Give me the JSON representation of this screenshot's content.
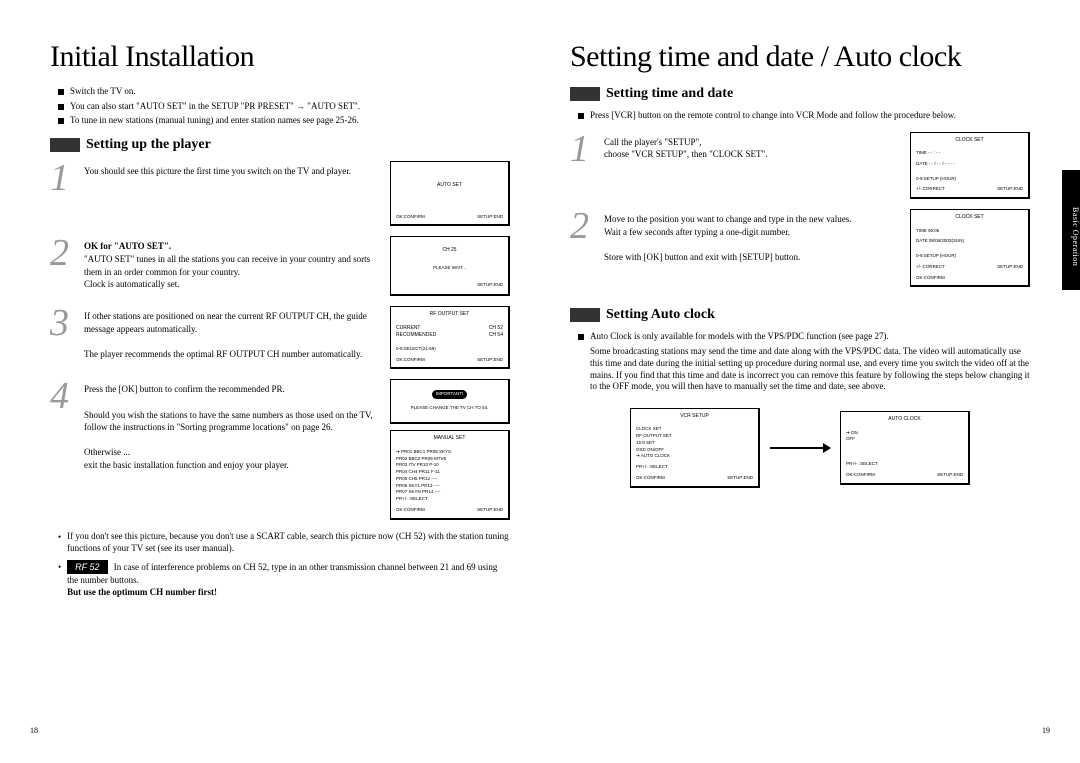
{
  "left": {
    "title": "Initial Installation",
    "intro": [
      "Switch the TV on.",
      "You can also start \"AUTO SET\" in the SETUP \"PR PRESET\"  →  \"AUTO SET\".",
      "To tune in new stations (manual tuning) and enter station names see page 25-26."
    ],
    "section1": "Setting up the player",
    "steps": {
      "s1": "You should see this picture the first time you switch on the TV and player.",
      "s2a": "OK for \"AUTO SET\".",
      "s2b": "\"AUTO SET\" tunes in all the stations you can receive in your country and sorts them in an order common for your country.",
      "s2c": "Clock is automatically set.",
      "s3a": "If other stations are positioned on near the current RF OUTPUT CH, the guide message appears automatically.",
      "s3b": "The player recommends the optimal RF OUTPUT CH number automatically.",
      "s4a": "Press the [OK] button to confirm the recommended PR.",
      "s4b": "Should you wish the stations to have the same numbers as those used on the TV, follow the instructions in \"Sorting programme locations\" on page 26.",
      "s4c": "Otherwise ...",
      "s4d": "exit the basic installation function and enjoy your player."
    },
    "osd1": {
      "title": "AUTO SET",
      "foot_l": "OK:CONFIRM",
      "foot_r": "SETUP:END"
    },
    "osd2": {
      "ch": "CH 25",
      "wait": "PLEASE WAIT...",
      "foot_r": "SETUP:END"
    },
    "osd3": {
      "title": "RF OUTPUT SET",
      "l1": "CURRENT",
      "v1": "CH 52",
      "l2": "RECOMMENDED",
      "v2": "CH 54",
      "foot_m": "0-9:SELECT(21-69)",
      "foot_l": "OK:CONFIRM",
      "foot_r": "SETUP:END"
    },
    "osd4": {
      "important": "IMPORTANT!",
      "msg": "PLEASE CHANGE THE TV CH TO 54."
    },
    "osd5": {
      "title": "MANUAL SET",
      "rows": [
        "➔ PR01 BBC1  PR08 SKYS",
        "PR02 BBC2  PR09 MTVE",
        "PR03 ITV   PR10 P-10",
        "PR04 CH4   PR11 F-11",
        "PR05 CH5   PR12 ----",
        "PR06 SKY1  PR13 ----",
        "PR07 SKYN  PR14 ----"
      ],
      "foot_m": "PR+/- :SELECT",
      "foot_l": "OK:CONFIRM",
      "foot_r": "SETUP:END"
    },
    "note1": "If you don't see this picture, because you don't use a SCART cable, search this picture now (CH 52) with the station tuning functions of your TV set (see its user manual).",
    "rf_label": "RF 52",
    "note2": "In case of interference problems on CH 52, type in an other transmission channel between 21 and 69 using the number buttons.",
    "note2b": "But use the optimum CH number first!",
    "page": "18"
  },
  "right": {
    "title": "Setting time and date / Auto clock",
    "section1": "Setting time and date",
    "intro1": "Press [VCR] button on the remote control to change into VCR Mode and follow the procedure below.",
    "steps": {
      "s1a": "Call the player's \"SETUP\",",
      "s1b": "choose \"VCR SETUP\", then \"CLOCK SET\".",
      "s2a": "Move to the position you want to change and type in the new values.",
      "s2b": "Wait a few seconds after typing a one-digit number.",
      "s2c": "Store with [OK] button and exit with [SETUP] button."
    },
    "osd1": {
      "title": "CLOCK SET",
      "time": "TIME   - - : - -",
      "date": "DATE   - - / - - / - - - -",
      "foot_m": "0-9:SETUP (HOUR)",
      "foot_m2": "+/-:CORRECT",
      "foot_r": "SETUP:END"
    },
    "osd2": {
      "title": "CLOCK SET",
      "time": "TIME   06:05",
      "date": "DATE   08/06/2003(SUN)",
      "foot_m": "0-9:SETUP (HOUR)",
      "foot_m2": "+/-:CORRECT",
      "foot_r": "SETUP:END",
      "foot_ok": "OK:CONFIRM"
    },
    "section2": "Setting Auto clock",
    "intro2": [
      "Auto Clock is only available for models with the VPS/PDC function (see page 27).",
      "Some broadcasting stations may send the time and date along with the VPS/PDC data. The video will automatically use this time and date during the initial setting up procedure during normal use, and every time you switch the video off at the mains. If you find that this time and date is incorrect you can remove this feature by following the steps below changing it to the OFF mode, you will then have to manually set the time and date, see above."
    ],
    "osdv": {
      "title": "VCR SETUP",
      "rows": [
        "CLOCK SET",
        "RF OUTPUT SET",
        "16:9 SET",
        "OSD ON/OFF",
        "➔ AUTO CLOCK"
      ],
      "foot_m": "PR+/- :SELECT",
      "foot_l": "OK:CONFIRM",
      "foot_r": "SETUP:END"
    },
    "osda": {
      "title": "AUTO CLOCK",
      "rows": [
        "➔ ON",
        "OFF"
      ],
      "foot_m": "PR+/- :SELECT",
      "foot_l": "OK:CONFIRM",
      "foot_r": "SETUP:END"
    },
    "page": "19",
    "tab": "Basic Operation"
  }
}
